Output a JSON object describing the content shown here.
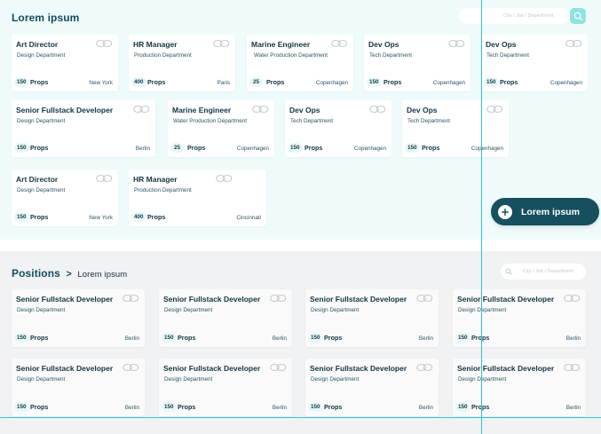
{
  "top": {
    "title": "Lorem ipsum",
    "search_placeholder": "City / Job / Department"
  },
  "fab": {
    "label": "Lorem ipsum"
  },
  "bottom": {
    "title": "Positions",
    "separator": ">",
    "subtitle": "Lorem ipsum",
    "search_placeholder": "City / Job / Department"
  },
  "props_label": "Props",
  "top_cards": [
    {
      "title": "Art Director",
      "dept": "Design Department",
      "count": "150",
      "city": "New York"
    },
    {
      "title": "HR Manager",
      "dept": "Production Department",
      "count": "400",
      "city": "Paris"
    },
    {
      "title": "Marine Engineer",
      "dept": "Water Production Department",
      "count": "25",
      "city": "Copenhagen"
    },
    {
      "title": "Dev Ops",
      "dept": "Tech Department",
      "count": "150",
      "city": "Copenhagen"
    },
    {
      "title": "Dev Ops",
      "dept": "Tech Department",
      "count": "150",
      "city": "Copenhagen"
    },
    {
      "title": "Senior Fullstack Developer",
      "dept": "Design Department",
      "count": "150",
      "city": "Berlin"
    },
    {
      "title": "Marine Engineer",
      "dept": "Water Production Department",
      "count": "25",
      "city": "Copenhagen"
    },
    {
      "title": "Dev Ops",
      "dept": "Tech Department",
      "count": "150",
      "city": "Copenhagen"
    },
    {
      "title": "Dev Ops",
      "dept": "Tech Department",
      "count": "150",
      "city": "Copenhagen"
    },
    {
      "title": "Art Director",
      "dept": "Design Department",
      "count": "150",
      "city": "New York"
    },
    {
      "title": "HR Manager",
      "dept": "Production Department",
      "count": "400",
      "city": "Cincinnati"
    }
  ],
  "position_cards": [
    {
      "title": "Senior Fullstack Developer",
      "dept": "Design Department",
      "count": "150",
      "city": "Berlin"
    },
    {
      "title": "Senior Fullstack Developer",
      "dept": "Design Department",
      "count": "150",
      "city": "Berlin"
    },
    {
      "title": "Senior Fullstack Developer",
      "dept": "Design Department",
      "count": "150",
      "city": "Berlin"
    },
    {
      "title": "Senior Fullstack Developer",
      "dept": "Design Department",
      "count": "150",
      "city": "Berlin"
    },
    {
      "title": "Senior Fullstack Developer",
      "dept": "Design Department",
      "count": "150",
      "city": "Berlin"
    },
    {
      "title": "Senior Fullstack Developer",
      "dept": "Design Department",
      "count": "150",
      "city": "Berlin"
    },
    {
      "title": "Senior Fullstack Developer",
      "dept": "Design Department",
      "count": "150",
      "city": "Berlin"
    },
    {
      "title": "Senior Fullstack Developer",
      "dept": "Design Department",
      "count": "150",
      "city": "Berlin"
    }
  ],
  "icons": {
    "card": "link-icon",
    "search": "search-icon",
    "fab": "plus-icon"
  },
  "colors": {
    "primary": "#16505f",
    "accent": "#8fe3e0",
    "top_bg": "#eefbfa",
    "bottom_bg": "#f1f2f4",
    "guide": "#29c4d3"
  }
}
